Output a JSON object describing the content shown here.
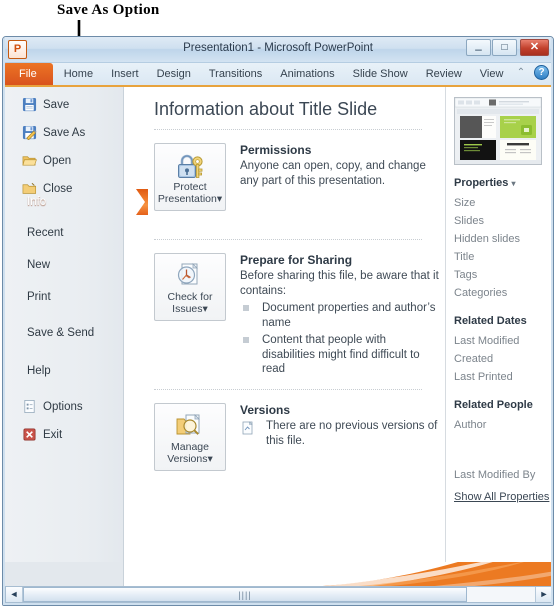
{
  "annotation": {
    "text": "Save As Option"
  },
  "titlebar": {
    "app_initial": "P",
    "title": "Presentation1  -  Microsoft PowerPoint",
    "minimize": "–",
    "maximize": "□",
    "close": "✕"
  },
  "ribbon": {
    "tabs": [
      {
        "label": "File",
        "active": true
      },
      {
        "label": "Home"
      },
      {
        "label": "Insert"
      },
      {
        "label": "Design"
      },
      {
        "label": "Transitions"
      },
      {
        "label": "Animations"
      },
      {
        "label": "Slide Show"
      },
      {
        "label": "Review"
      },
      {
        "label": "View"
      }
    ],
    "collapse_icon": "⌃",
    "help_label": "?"
  },
  "leftnav": {
    "items": [
      {
        "label": "Save",
        "icon": "save-icon"
      },
      {
        "label": "Save As",
        "icon": "save-as-icon"
      },
      {
        "label": "Open",
        "icon": "open-folder-icon"
      },
      {
        "label": "Close",
        "icon": "close-folder-icon"
      },
      {
        "label": "Info",
        "icon": "",
        "selected": true
      },
      {
        "label": "Recent",
        "icon": ""
      },
      {
        "label": "New",
        "icon": ""
      },
      {
        "label": "Print",
        "icon": ""
      },
      {
        "label": "Save & Send",
        "icon": ""
      },
      {
        "label": "Help",
        "icon": ""
      },
      {
        "label": "Options",
        "icon": "options-icon"
      },
      {
        "label": "Exit",
        "icon": "exit-icon"
      }
    ]
  },
  "center": {
    "heading": "Information about Title Slide",
    "permissions": {
      "button_label_line1": "Protect",
      "button_label_line2": "Presentation",
      "button_caret": "▾",
      "title": "Permissions",
      "text": "Anyone can open, copy, and change any part of this presentation."
    },
    "prepare": {
      "button_label_line1": "Check for",
      "button_label_line2": "Issues",
      "button_caret": "▾",
      "title": "Prepare for Sharing",
      "text": "Before sharing this file, be aware that it contains:",
      "bullets": [
        "Document properties and author’s name",
        "Content that people with disabilities might find difficult to read"
      ]
    },
    "versions": {
      "button_label_line1": "Manage",
      "button_label_line2": "Versions",
      "button_caret": "▾",
      "title": "Versions",
      "text": "There are no previous versions of this file."
    }
  },
  "rightpane": {
    "properties_heading": "Properties",
    "properties_caret": "▾",
    "properties": [
      "Size",
      "Slides",
      "Hidden slides",
      "Title",
      "Tags",
      "Categories"
    ],
    "related_dates_heading": "Related Dates",
    "related_dates": [
      "Last Modified",
      "Created",
      "Last Printed"
    ],
    "related_people_heading": "Related People",
    "related_people": [
      "Author"
    ],
    "last_modified_by": "Last Modified By",
    "show_all": "Show All Properties"
  },
  "scrollbar": {
    "left_arrow": "◄",
    "right_arrow": "►",
    "grip": "||||"
  },
  "colors": {
    "accent_orange": "#e05a12",
    "file_tab": "#dd5e20",
    "ribbon_rule": "#e8a33d",
    "close_red": "#c2402c"
  }
}
